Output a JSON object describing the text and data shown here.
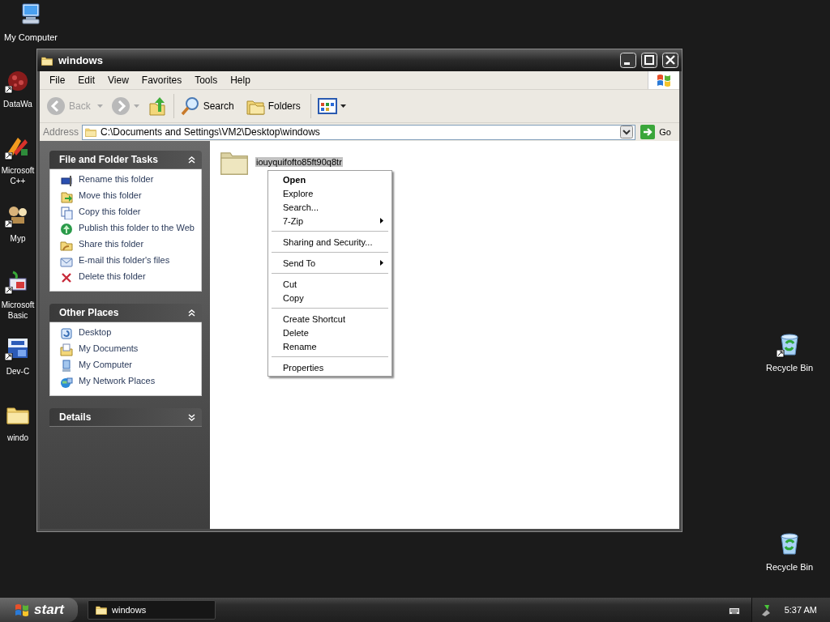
{
  "desktop_icons": [
    {
      "label": "My Computer",
      "kind": "computer",
      "shortcut": false
    },
    {
      "label": "DataWa",
      "kind": "web",
      "shortcut": true
    },
    {
      "label": "Microsoft C++",
      "kind": "studio",
      "shortcut": true
    },
    {
      "label": "Myp",
      "kind": "tools",
      "shortcut": true
    },
    {
      "label": "Microsoft Basic",
      "kind": "basic",
      "shortcut": true
    },
    {
      "label": "Dev-C",
      "kind": "devc",
      "shortcut": true
    },
    {
      "label": "windo",
      "kind": "folder",
      "shortcut": false
    }
  ],
  "right_icons": [
    {
      "label": "Recycle Bin",
      "kind": "recycle",
      "shortcut": true
    },
    {
      "label": "Recycle Bin",
      "kind": "recycle",
      "shortcut": false
    }
  ],
  "window": {
    "title": "windows",
    "menu": [
      "File",
      "Edit",
      "View",
      "Favorites",
      "Tools",
      "Help"
    ],
    "toolbar": [
      {
        "kind": "back",
        "label": "Back",
        "disabled": true
      },
      {
        "kind": "forward",
        "disabled": true
      },
      {
        "kind": "up",
        "disabled": false
      },
      {
        "kind": "search",
        "label": "Search",
        "disabled": false
      },
      {
        "kind": "folders",
        "label": "Folders",
        "disabled": false
      },
      {
        "kind": "views",
        "disabled": false
      }
    ],
    "address": {
      "label": "Address",
      "value": "C:\\Documents and Settings\\VM2\\Desktop\\windows",
      "go": "Go"
    },
    "panels": [
      {
        "title": "File and Folder Tasks",
        "expanded": true,
        "items": [
          {
            "label": "Rename this folder",
            "kind": "rename"
          },
          {
            "label": "Move this folder",
            "kind": "move"
          },
          {
            "label": "Copy this folder",
            "kind": "copy"
          },
          {
            "label": "Publish this folder to the Web",
            "kind": "publish"
          },
          {
            "label": "Share this folder",
            "kind": "share"
          },
          {
            "label": "E-mail this folder's files",
            "kind": "email"
          },
          {
            "label": "Delete this folder",
            "kind": "delete"
          }
        ]
      },
      {
        "title": "Other Places",
        "expanded": true,
        "items": [
          {
            "label": "Desktop",
            "kind": "desktop"
          },
          {
            "label": "My Documents",
            "kind": "documents"
          },
          {
            "label": "My Computer",
            "kind": "computer"
          },
          {
            "label": "My Network Places",
            "kind": "network"
          }
        ]
      },
      {
        "title": "Details",
        "expanded": false
      }
    ],
    "files": [
      {
        "name": "iouyquifofto85ft90q8tr",
        "selected": true
      }
    ]
  },
  "context_menu": {
    "groups": [
      [
        {
          "label": "Open",
          "default": true,
          "submenu": false
        },
        {
          "label": "Explore",
          "default": false,
          "submenu": false
        },
        {
          "label": "Search...",
          "default": false,
          "submenu": false
        },
        {
          "label": "7-Zip",
          "default": false,
          "submenu": true
        }
      ],
      [
        {
          "label": "Sharing and Security...",
          "default": false,
          "submenu": false
        }
      ],
      [
        {
          "label": "Send To",
          "default": false,
          "submenu": true
        }
      ],
      [
        {
          "label": "Cut",
          "default": false,
          "submenu": false
        },
        {
          "label": "Copy",
          "default": false,
          "submenu": false
        }
      ],
      [
        {
          "label": "Create Shortcut",
          "default": false,
          "submenu": false
        },
        {
          "label": "Delete",
          "default": false,
          "submenu": false
        },
        {
          "label": "Rename",
          "default": false,
          "submenu": false
        }
      ],
      [
        {
          "label": "Properties",
          "default": false,
          "submenu": false
        }
      ]
    ]
  },
  "taskbar": {
    "start": "start",
    "tasks": [
      {
        "label": "windows"
      }
    ],
    "clock": "5:37 AM"
  }
}
